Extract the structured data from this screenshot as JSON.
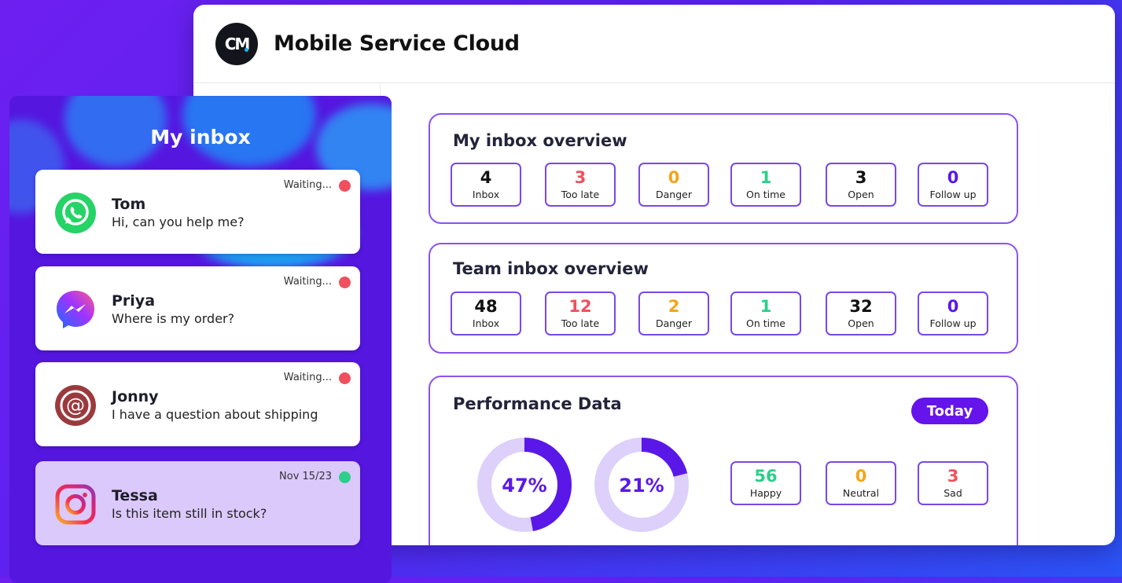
{
  "app": {
    "logo_text": "CM",
    "title": "Mobile Service Cloud"
  },
  "my_inbox_overview": {
    "title": "My inbox overview",
    "stats": [
      {
        "value": "4",
        "label": "Inbox",
        "color": "#111111"
      },
      {
        "value": "3",
        "label": "Too late",
        "color": "#f0505e"
      },
      {
        "value": "0",
        "label": "Danger",
        "color": "#f6a31b"
      },
      {
        "value": "1",
        "label": "On time",
        "color": "#2cce8a"
      },
      {
        "value": "3",
        "label": "Open",
        "color": "#111111"
      },
      {
        "value": "0",
        "label": "Follow up",
        "color": "#5a18e8"
      }
    ]
  },
  "team_inbox_overview": {
    "title": "Team inbox overview",
    "stats": [
      {
        "value": "48",
        "label": "Inbox",
        "color": "#111111"
      },
      {
        "value": "12",
        "label": "Too late",
        "color": "#f0505e"
      },
      {
        "value": "2",
        "label": "Danger",
        "color": "#f6a31b"
      },
      {
        "value": "1",
        "label": "On time",
        "color": "#2cce8a"
      },
      {
        "value": "32",
        "label": "Open",
        "color": "#111111"
      },
      {
        "value": "0",
        "label": "Follow up",
        "color": "#5a18e8"
      }
    ]
  },
  "performance": {
    "title": "Performance Data",
    "period_button": "Today",
    "donuts": [
      {
        "label": "47%",
        "fraction": 0.47
      },
      {
        "label": "21%",
        "fraction": 0.21
      }
    ],
    "sentiment": [
      {
        "value": "56",
        "label": "Happy",
        "color": "#2cce8a"
      },
      {
        "value": "0",
        "label": "Neutral",
        "color": "#f6a31b"
      },
      {
        "value": "3",
        "label": "Sad",
        "color": "#f0505e"
      }
    ]
  },
  "inbox_panel": {
    "title": "My inbox",
    "messages": [
      {
        "name": "Tom",
        "text": "Hi, can you help me?",
        "status": "Waiting...",
        "status_color": "#f0505e",
        "channel_icon": "whatsapp-icon"
      },
      {
        "name": "Priya",
        "text": "Where is my order?",
        "status": "Waiting...",
        "status_color": "#f0505e",
        "channel_icon": "messenger-icon"
      },
      {
        "name": "Jonny",
        "text": "I have a question about shipping",
        "status": "Waiting...",
        "status_color": "#f0505e",
        "channel_icon": "email-icon"
      },
      {
        "name": "Tessa",
        "text": "Is this item still in stock?",
        "status": "Nov 15/23",
        "status_color": "#2cce8a",
        "channel_icon": "instagram-icon"
      }
    ]
  },
  "colors": {
    "accent": "#6514ec",
    "card_border": "#8a52f0",
    "donut_track": "#ddd0fb",
    "donut_fill": "#5a18e8"
  }
}
